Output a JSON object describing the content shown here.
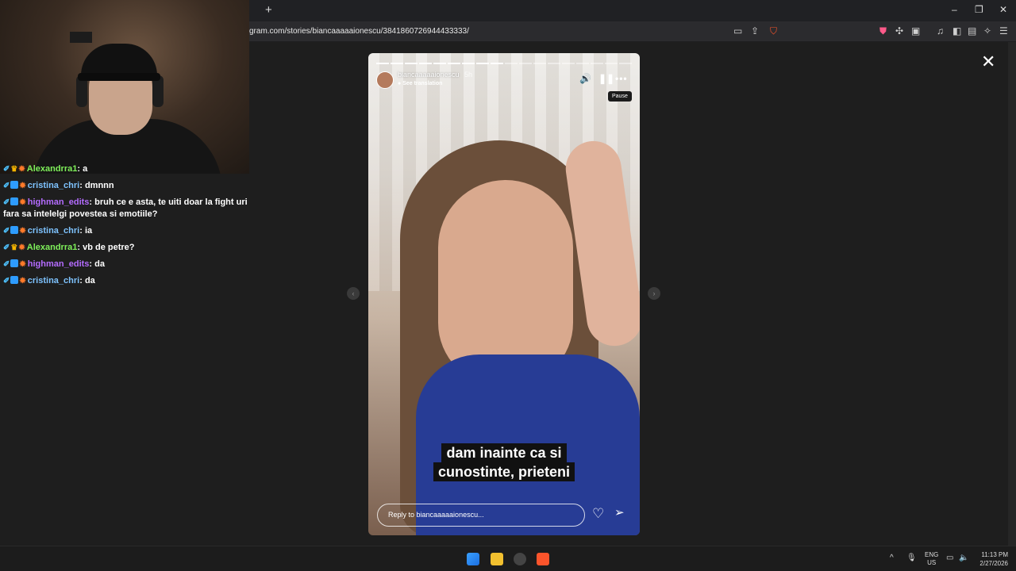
{
  "browser": {
    "new_tab_glyph": "+",
    "url": "gram.com/stories/biancaaaaaionescu/3841860726944433333/",
    "window_controls": [
      "–",
      "❐",
      "✕"
    ]
  },
  "chat": {
    "messages": [
      {
        "user": "Alexandrra1",
        "text": "a",
        "user_color": "#7ff05a",
        "badges": [
          "sword",
          "crown",
          "orange"
        ]
      },
      {
        "user": "cristina_chri",
        "text": "dmnnn",
        "user_color": "#7ec3ff",
        "badges": [
          "sword",
          "blue",
          "orange"
        ]
      },
      {
        "user": "highman_edits",
        "text": "bruh ce e asta, te uiti doar la fight uri fara sa intelelgi povestea si emotiile?",
        "user_color": "#b46cff",
        "badges": [
          "sword",
          "blue",
          "orange"
        ]
      },
      {
        "user": "cristina_chri",
        "text": "ia",
        "user_color": "#7ec3ff",
        "badges": [
          "sword",
          "blue",
          "orange"
        ]
      },
      {
        "user": "Alexandrra1",
        "text": "vb de petre?",
        "user_color": "#7ff05a",
        "badges": [
          "sword",
          "crown",
          "orange"
        ]
      },
      {
        "user": "highman_edits",
        "text": "da",
        "user_color": "#b46cff",
        "badges": [
          "sword",
          "blue",
          "orange"
        ]
      },
      {
        "user": "cristina_chri",
        "text": "da",
        "user_color": "#7ec3ff",
        "badges": [
          "sword",
          "blue",
          "orange"
        ]
      }
    ]
  },
  "story": {
    "username": "biancaaaaaionescu",
    "time_ago": "5h",
    "see_translation": "See translation",
    "tooltip": "Pause",
    "caption_line1": "dam inainte ca si",
    "caption_line2": "cunostinte, prieteni",
    "reply_placeholder": "Reply to biancaaaaaionescu...",
    "progress_total": 18,
    "progress_done": 9
  },
  "taskbar": {
    "lang_line1": "ENG",
    "lang_line2": "US",
    "time": "11:13 PM",
    "date": "2/27/2026"
  },
  "colors": {
    "accent_brave": "#fb542b",
    "hoodie": "#273c95"
  }
}
